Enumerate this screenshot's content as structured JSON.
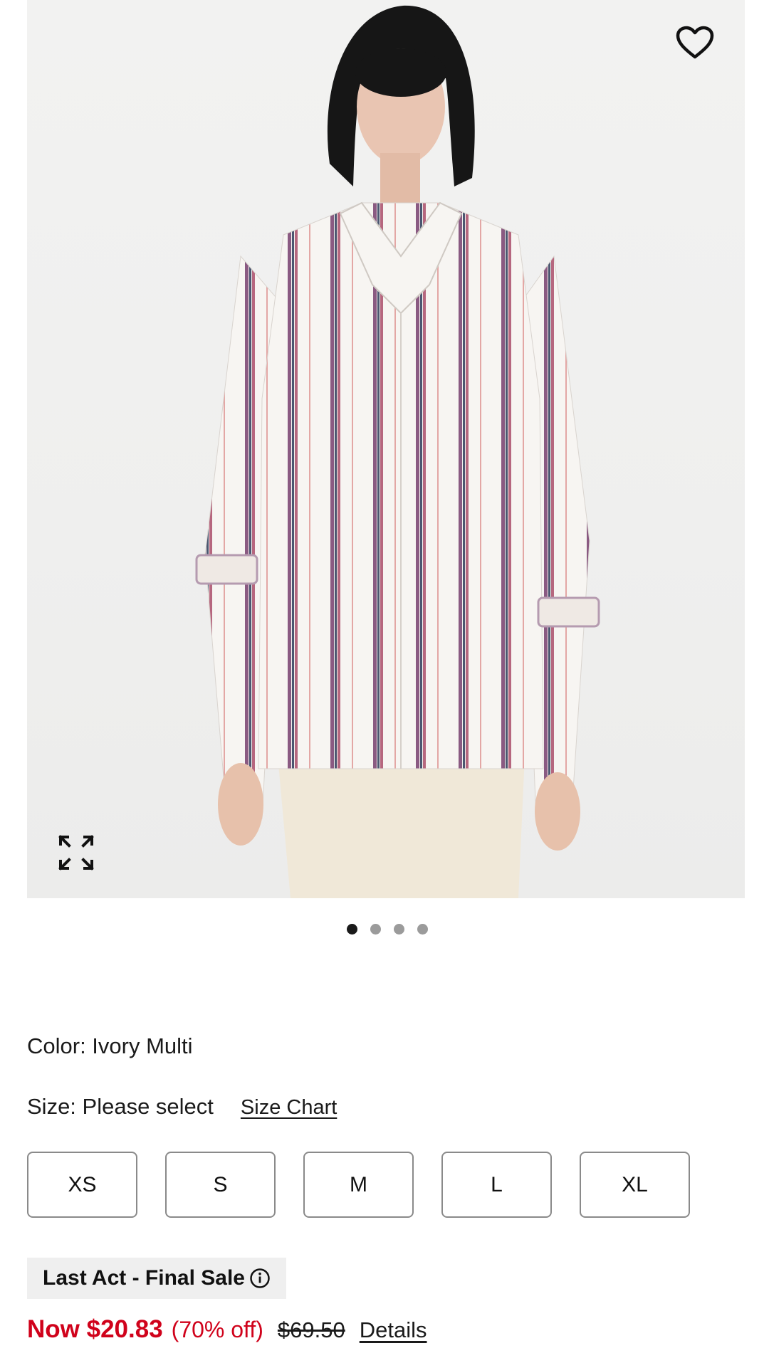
{
  "product_image": {
    "dots_count": 4,
    "active_index": 0
  },
  "icons": {
    "favorite": "heart-outline-icon",
    "expand": "expand-arrows-icon",
    "info": "info-circle-icon"
  },
  "color": {
    "label": "Color: Ivory Multi"
  },
  "size": {
    "label": "Size: Please select",
    "chart_link": "Size Chart",
    "options": [
      "XS",
      "S",
      "M",
      "L",
      "XL"
    ]
  },
  "badge": {
    "text": "Last Act - Final Sale"
  },
  "price": {
    "now": "Now $20.83",
    "percent_off": "(70% off)",
    "original": "$69.50",
    "details": "Details"
  },
  "colors": {
    "sale_red": "#d0021b",
    "border": "#8a8a8a",
    "badge_bg": "#efefef"
  }
}
